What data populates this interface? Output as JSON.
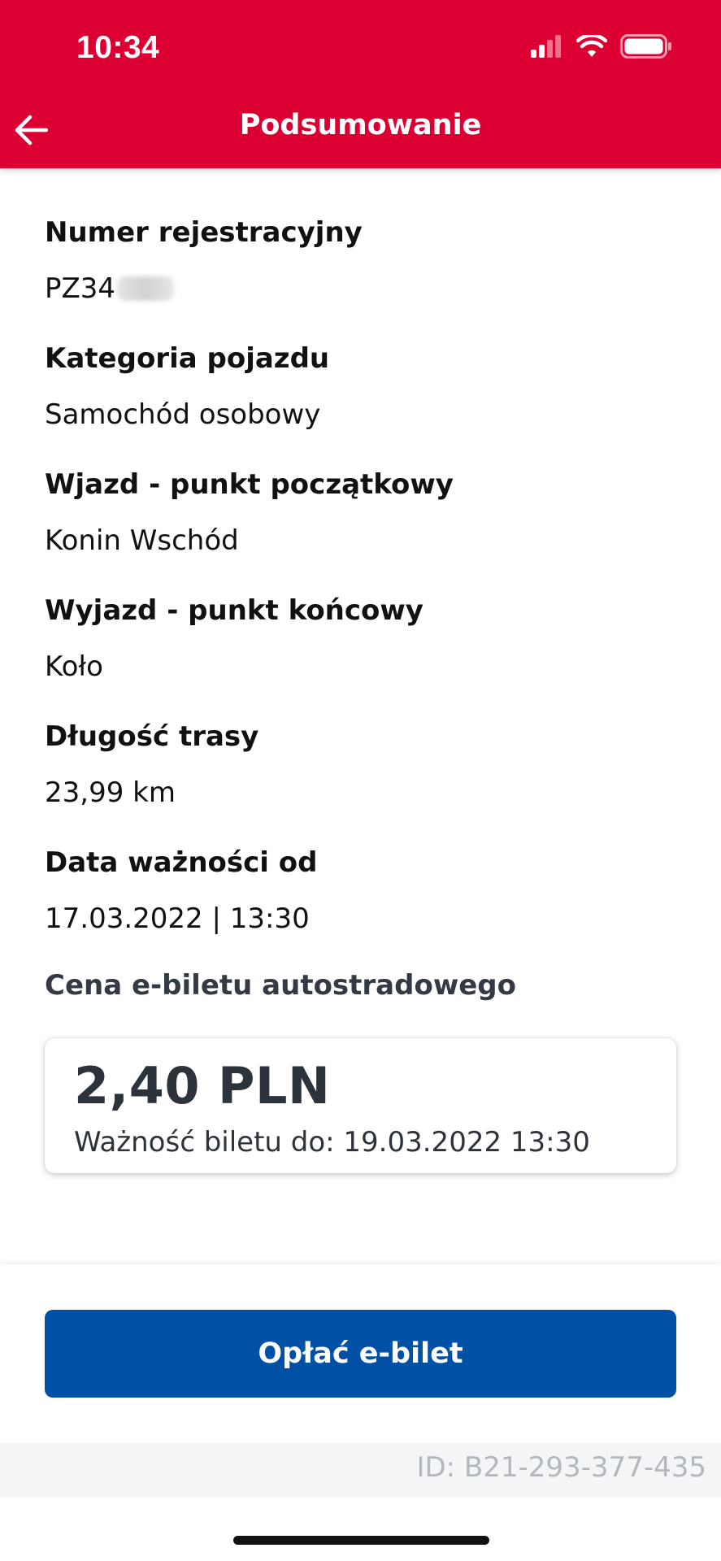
{
  "status_bar": {
    "time": "10:34",
    "icons": [
      "signal-icon",
      "wifi-icon",
      "battery-icon"
    ]
  },
  "header": {
    "title": "Podsumowanie",
    "back_icon": "arrow-left-icon",
    "background_color": "#DC0032"
  },
  "summary": {
    "registration_label": "Numer rejestracyjny",
    "registration_value": "PZ34",
    "vehicle_category_label": "Kategoria pojazdu",
    "vehicle_category_value": "Samochód osobowy",
    "entry_label": "Wjazd - punkt początkowy",
    "entry_value": "Konin Wschód",
    "exit_label": "Wyjazd - punkt końcowy",
    "exit_value": "Koło",
    "route_length_label": "Długość trasy",
    "route_length_value": "23,99 km",
    "valid_from_label": "Data ważności od",
    "valid_from_value": "17.03.2022 | 13:30"
  },
  "price": {
    "label": "Cena e-biletu autostradowego",
    "amount": "2,40 PLN",
    "validity": "Ważność biletu do: 19.03.2022 13:30"
  },
  "actions": {
    "pay_button_label": "Opłać e-bilet",
    "pay_button_color": "#0051A5"
  },
  "footer": {
    "id_text": "ID: B21-293-377-435"
  }
}
